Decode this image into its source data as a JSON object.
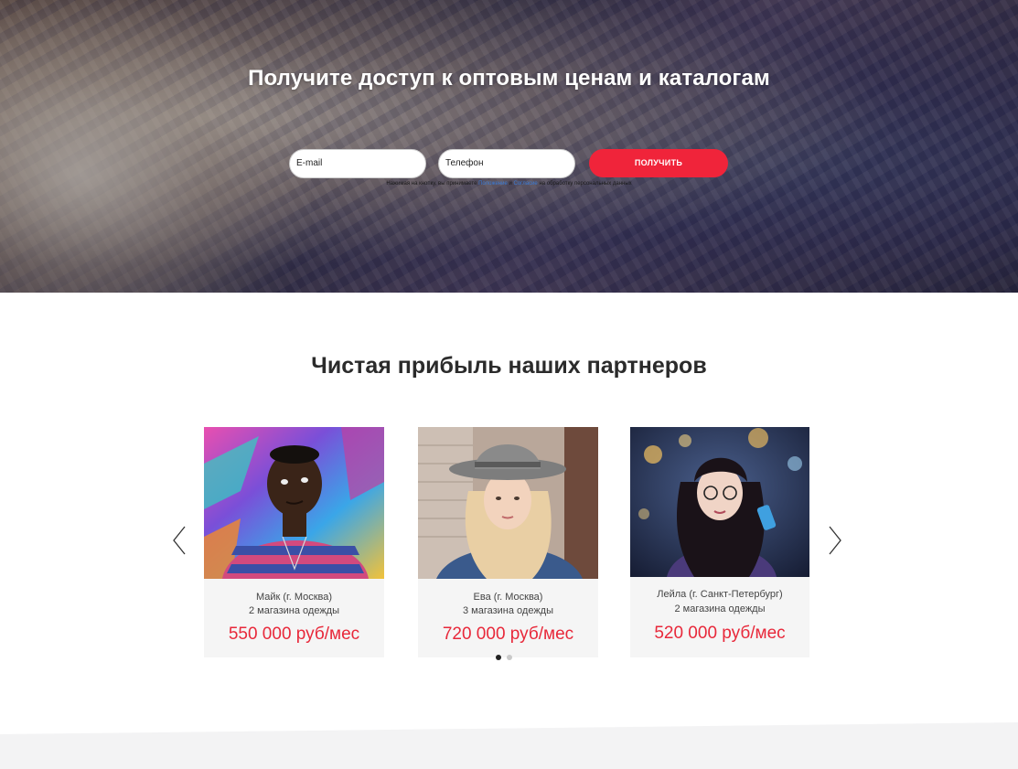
{
  "hero": {
    "title": "Получите доступ к оптовым ценам и каталогам",
    "email_placeholder": "E-mail",
    "phone_placeholder": "Телефон",
    "submit_label": "ПОЛУЧИТЬ",
    "consent_prefix": "Нажимая на кнопку, вы принимаете",
    "consent_link_1": "Положение",
    "consent_and": "и",
    "consent_link_2": "Согласие",
    "consent_suffix": "на обработку персональных данных"
  },
  "partners": {
    "title": "Чистая прибыль наших партнеров",
    "cards": [
      {
        "name": "Майк (г. Москва)",
        "shops": "2 магазина одежды",
        "income": "550 000 руб/мес"
      },
      {
        "name": "Ева (г. Москва)",
        "shops": "3 магазина одежды",
        "income": "720 000 руб/мес"
      },
      {
        "name": "Лейла (г. Санкт-Петербург)",
        "shops": "2 магазина одежды",
        "income": "520 000 руб/мес"
      }
    ],
    "prev_icon": "chevron-left-icon",
    "next_icon": "chevron-right-icon",
    "active_slide": 1,
    "slide_count": 2
  },
  "colors": {
    "accent": "#f0243a",
    "income": "#e8283a",
    "link": "#3a7bd5",
    "card_bg": "#f5f5f5"
  }
}
